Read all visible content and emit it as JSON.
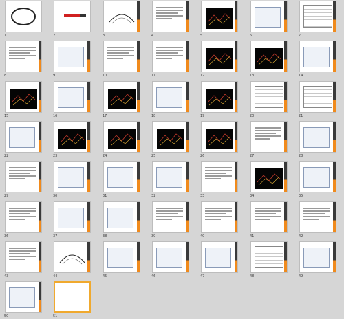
{
  "window": {
    "title": ""
  },
  "slides": [
    {
      "n": "1",
      "kind": "logo"
    },
    {
      "n": "2",
      "kind": "title"
    },
    {
      "n": "3",
      "kind": "curve"
    },
    {
      "n": "4",
      "kind": "text"
    },
    {
      "n": "5",
      "kind": "dialog-dark"
    },
    {
      "n": "6",
      "kind": "dialog"
    },
    {
      "n": "7",
      "kind": "table"
    },
    {
      "n": "8",
      "kind": "text"
    },
    {
      "n": "9",
      "kind": "dialog"
    },
    {
      "n": "10",
      "kind": "text"
    },
    {
      "n": "11",
      "kind": "text"
    },
    {
      "n": "12",
      "kind": "dark"
    },
    {
      "n": "13",
      "kind": "dark"
    },
    {
      "n": "14",
      "kind": "dialog"
    },
    {
      "n": "15",
      "kind": "dark"
    },
    {
      "n": "16",
      "kind": "dialog"
    },
    {
      "n": "17",
      "kind": "dark"
    },
    {
      "n": "18",
      "kind": "dialog"
    },
    {
      "n": "19",
      "kind": "dark"
    },
    {
      "n": "20",
      "kind": "table"
    },
    {
      "n": "21",
      "kind": "table"
    },
    {
      "n": "22",
      "kind": "dialog"
    },
    {
      "n": "23",
      "kind": "dark"
    },
    {
      "n": "24",
      "kind": "dark"
    },
    {
      "n": "25",
      "kind": "dark"
    },
    {
      "n": "26",
      "kind": "dark"
    },
    {
      "n": "27",
      "kind": "text"
    },
    {
      "n": "28",
      "kind": "dialog"
    },
    {
      "n": "29",
      "kind": "text"
    },
    {
      "n": "30",
      "kind": "dialog"
    },
    {
      "n": "31",
      "kind": "dialog"
    },
    {
      "n": "32",
      "kind": "dialog"
    },
    {
      "n": "33",
      "kind": "text"
    },
    {
      "n": "34",
      "kind": "dark"
    },
    {
      "n": "35",
      "kind": "dialog"
    },
    {
      "n": "36",
      "kind": "text"
    },
    {
      "n": "37",
      "kind": "dialog"
    },
    {
      "n": "38",
      "kind": "dialog"
    },
    {
      "n": "39",
      "kind": "text"
    },
    {
      "n": "40",
      "kind": "text"
    },
    {
      "n": "41",
      "kind": "text"
    },
    {
      "n": "42",
      "kind": "text"
    },
    {
      "n": "43",
      "kind": "text"
    },
    {
      "n": "44",
      "kind": "curve"
    },
    {
      "n": "45",
      "kind": "dialog"
    },
    {
      "n": "46",
      "kind": "dialog"
    },
    {
      "n": "47",
      "kind": "dialog"
    },
    {
      "n": "48",
      "kind": "table"
    },
    {
      "n": "49",
      "kind": "dialog"
    },
    {
      "n": "50",
      "kind": "dialog"
    },
    {
      "n": "51",
      "kind": "blank",
      "selected": true
    }
  ],
  "colors": {
    "background": "#d6d6d6",
    "accent": "#f0a92e",
    "stripe_dark": "#3a3a3a",
    "stripe_orange": "#f08a1c"
  }
}
